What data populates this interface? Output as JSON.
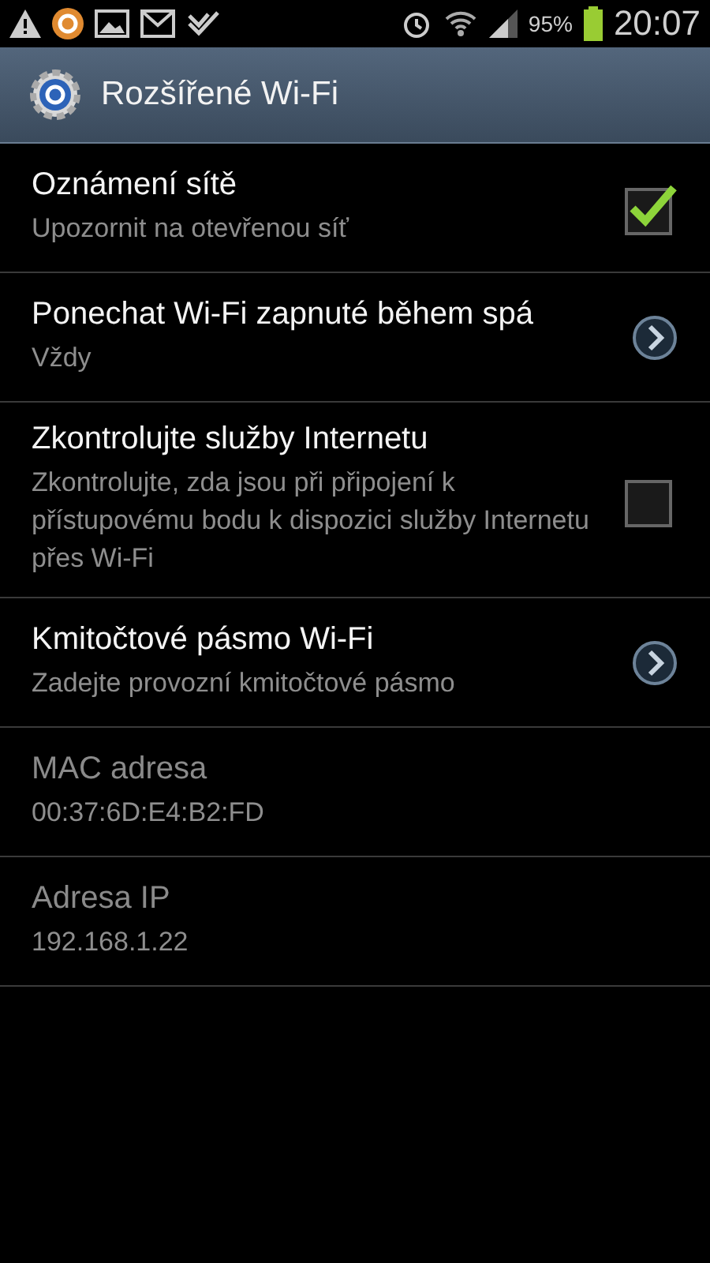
{
  "status_bar": {
    "battery": "95%",
    "time": "20:07"
  },
  "action_bar": {
    "title": "Rozšířené Wi-Fi"
  },
  "settings": [
    {
      "kind": "checkbox",
      "title": "Oznámení sítě",
      "summary": "Upozornit na otevřenou síť",
      "checked": true,
      "disabled": false
    },
    {
      "kind": "chevron",
      "title": "Ponechat Wi-Fi zapnuté během spá",
      "summary": "Vždy",
      "disabled": false
    },
    {
      "kind": "checkbox",
      "title": "Zkontrolujte služby Internetu",
      "summary": "Zkontrolujte, zda jsou při připojení k přístupovému bodu k dispozici služby Internetu přes Wi-Fi",
      "checked": false,
      "disabled": false
    },
    {
      "kind": "chevron",
      "title": "Kmitočtové pásmo Wi-Fi",
      "summary": "Zadejte provozní kmitočtové pásmo",
      "disabled": false
    },
    {
      "kind": "info",
      "title": "MAC adresa",
      "summary": "00:37:6D:E4:B2:FD",
      "disabled": true
    },
    {
      "kind": "info",
      "title": "Adresa IP",
      "summary": "192.168.1.22",
      "disabled": true
    }
  ]
}
